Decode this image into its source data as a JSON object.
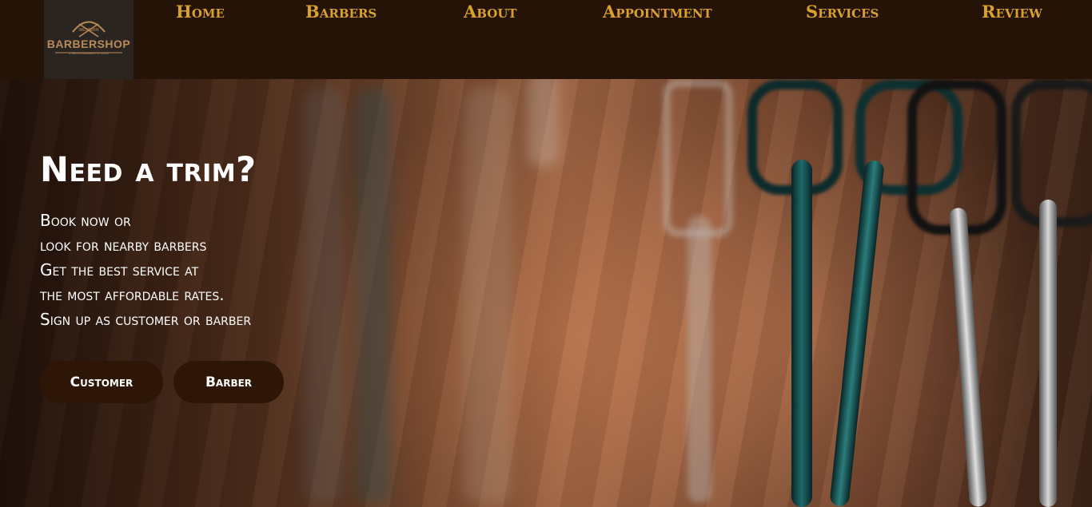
{
  "logo": {
    "top_small": "WESTERN",
    "name": "BARBERSHOP",
    "tagline": "& MEN'S BARBER STUDIO"
  },
  "nav": {
    "home": "Home",
    "barbers": "Barbers",
    "about": "About",
    "appointment": "Appointment",
    "services": "Services",
    "review": "Review"
  },
  "hero": {
    "title": "Need a trim?",
    "lines": [
      "Book now or",
      "look for nearby barbers",
      "Get the best service at",
      "the most affordable rates.",
      "Sign up as customer or barber"
    ],
    "customer_button": "Customer",
    "barber_button": "Barber"
  },
  "colors": {
    "nav_bg": "#251308",
    "nav_link": "#d9a02c",
    "button_bg": "#2e1607"
  }
}
